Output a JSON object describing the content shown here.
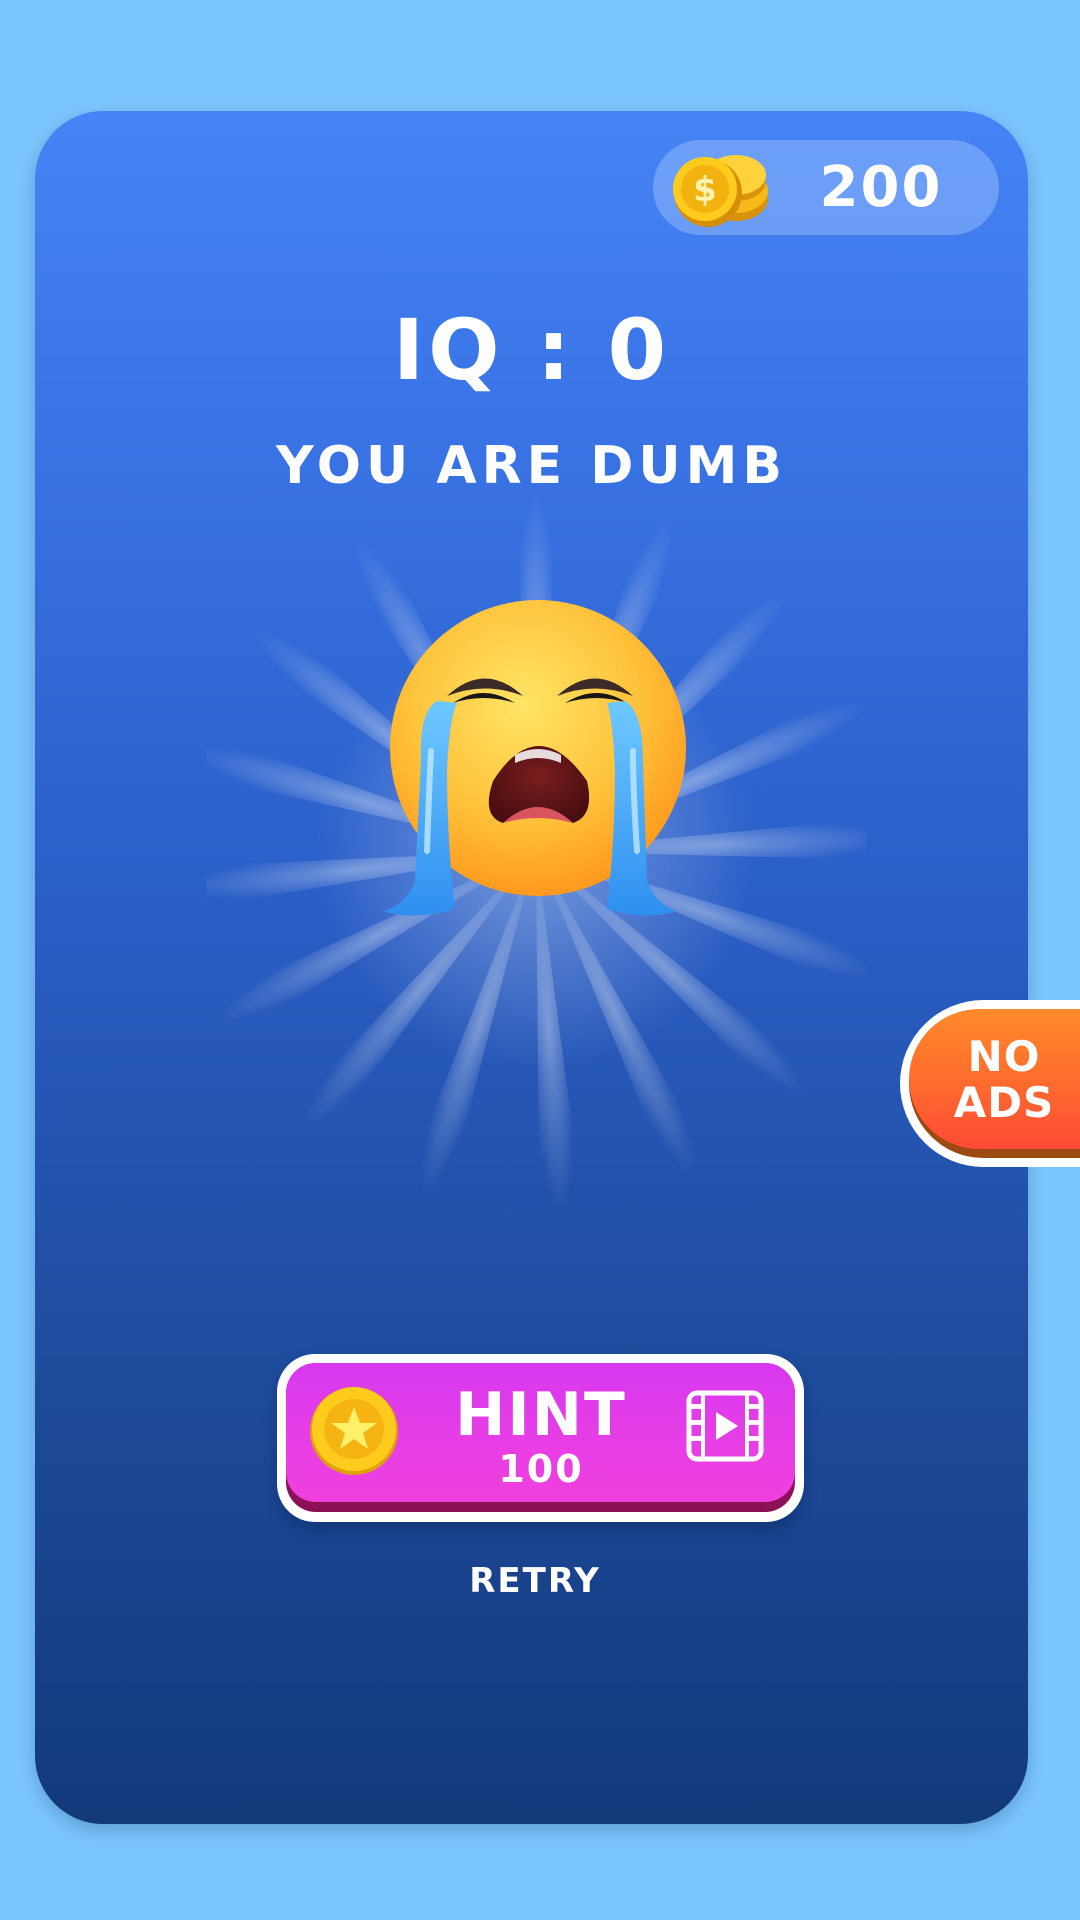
{
  "header": {
    "coins": "200",
    "coin_icon": "coin-stack-icon"
  },
  "result": {
    "iq_text": "IQ : 0",
    "verdict": "YOU ARE DUMB",
    "emoji": "loudly-crying-face"
  },
  "hint_button": {
    "label": "HINT",
    "cost": "100",
    "coin_icon": "star-coin-icon",
    "video_icon": "video-ad-icon"
  },
  "retry": {
    "label": "RETRY"
  },
  "no_ads": {
    "line1": "NO",
    "line2": "ADS"
  },
  "colors": {
    "background": "#7cc6fe",
    "card_top": "#4584f6",
    "card_bottom": "#12397a",
    "hint_button": "#e63ee6",
    "no_ads_button": "#ff6a2e",
    "coin_gold": "#f7c21a"
  }
}
